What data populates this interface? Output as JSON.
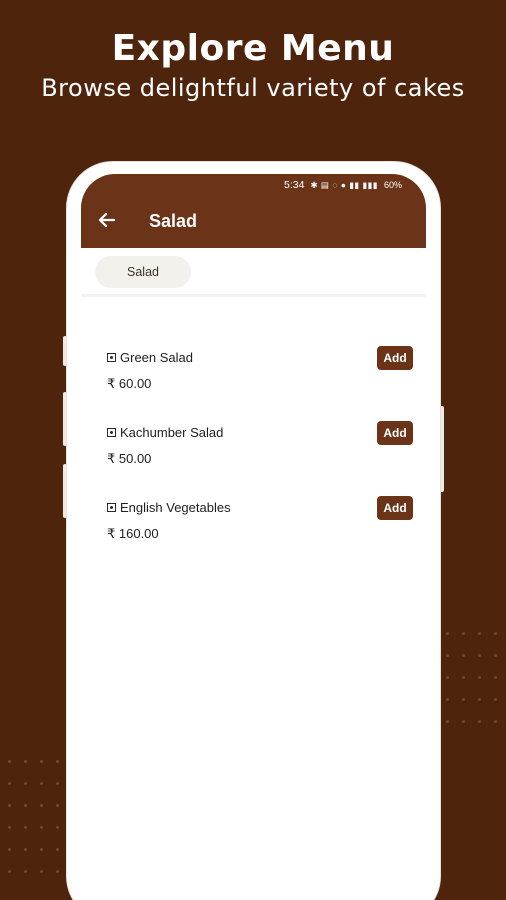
{
  "hero": {
    "title": "Explore Menu",
    "subtitle": "Browse delightful variety of cakes"
  },
  "status_bar": {
    "time": "5:34",
    "icons": "✱ ▤ ◌ ● ▮▮ ▮▮▮",
    "battery": "60%"
  },
  "app_bar": {
    "back_icon": "arrow-left-icon",
    "title": "Salad"
  },
  "category_chip": "Salad",
  "items": [
    {
      "name": "Green Salad",
      "price": "₹ 60.00",
      "button": "Add"
    },
    {
      "name": "Kachumber Salad",
      "price": "₹ 50.00",
      "button": "Add"
    },
    {
      "name": "English Vegetables",
      "price": "₹ 160.00",
      "button": "Add"
    }
  ],
  "colors": {
    "background": "#4f240c",
    "accent": "#6b3419",
    "chip": "#f3f1ec"
  }
}
